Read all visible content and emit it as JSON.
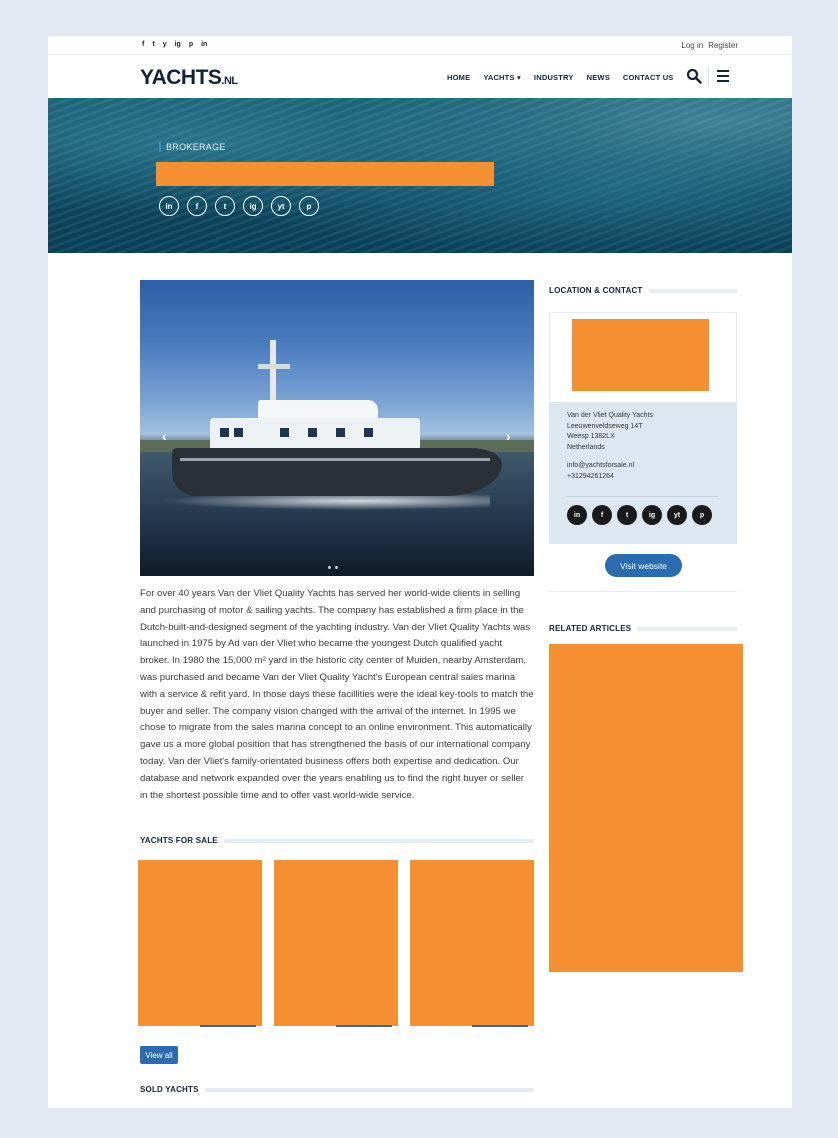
{
  "topbar": {
    "social": [
      "f",
      "t",
      "y",
      "ig",
      "p",
      "in"
    ],
    "login": "Log in",
    "register": "Register"
  },
  "nav": {
    "logo_main": "YACHTS",
    "logo_suffix": ".NL",
    "items": [
      "HOME",
      "YACHTS ▾",
      "INDUSTRY",
      "NEWS",
      "CONTACT US"
    ]
  },
  "hero": {
    "tag": "BROKERAGE",
    "social": [
      "in",
      "f",
      "t",
      "ig",
      "yt",
      "p"
    ]
  },
  "gallery": {
    "prev": "‹",
    "next": "›"
  },
  "description": "For over 40 years Van der Vliet Quality Yachts has served her world-wide clients in selling and purchasing of motor & sailing yachts. The company has established a firm place in the Dutch-built-and-designed segment of the yachting industry. Van der Vliet Quality Yachts was launched in 1975 by Ad van der Vliet who became the youngest Dutch qualified yacht broker. In 1980 the 15,000 m² yard in the historic city center of Muiden, nearby Amsterdam, was purchased and became Van der Vliet Quality Yacht's European central sales marina with a service & refit yard. In those days these facillities were the ideal key-tools to match the buyer and seller. The company vision changed with the arrival of the internet. In 1995 we chose to migrate from the sales marina concept to an online environment. This automatically gave us a more global position that has strengthened the basis of our international company today. Van der Vliet's family-orientated business offers both expertise and dedication. Our database and network expanded over the years enabling us to find the right buyer or seller in the shortest possible time and to offer vast world-wide service.",
  "sections": {
    "yachts_for_sale": "YACHTS FOR SALE",
    "view_all": "View all",
    "sold_yachts": "SOLD YACHTS",
    "location_contact": "LOCATION & CONTACT",
    "related_articles": "RELATED ARTICLES"
  },
  "contact": {
    "name": "Van der Vliet Quality Yachts",
    "street": "Leeuwenveldseweg 14T",
    "city": "Weesp 1382LX",
    "country": "Netherlands",
    "email": "info@yachtsforsale.nl",
    "phone": "+31294261264",
    "social": [
      "in",
      "f",
      "t",
      "ig",
      "yt",
      "p"
    ],
    "visit_label": "Visit website"
  },
  "colors": {
    "accent": "#2b6cb0",
    "redacted": "#f58f31",
    "navy": "#14233a"
  }
}
